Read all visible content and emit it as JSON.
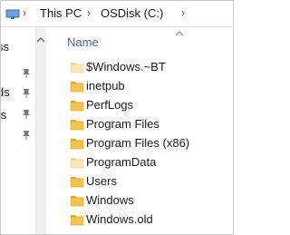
{
  "address": {
    "crumbs": [
      "This PC",
      "OSDisk (C:)"
    ],
    "separators": [
      "›",
      "›",
      "›"
    ]
  },
  "left_pane": {
    "labels": [
      "ss",
      "ds",
      "ts"
    ]
  },
  "column": {
    "name": "Name"
  },
  "folders": [
    {
      "name": "$Windows.~BT",
      "style": "hidden"
    },
    {
      "name": "inetpub",
      "style": "normal"
    },
    {
      "name": "PerfLogs",
      "style": "normal"
    },
    {
      "name": "Program Files",
      "style": "normal"
    },
    {
      "name": "Program Files (x86)",
      "style": "normal"
    },
    {
      "name": "ProgramData",
      "style": "hidden"
    },
    {
      "name": "Users",
      "style": "normal"
    },
    {
      "name": "Windows",
      "style": "normal"
    },
    {
      "name": "Windows.old",
      "style": "normal"
    }
  ],
  "colors": {
    "folder_normal": "#f4c54a",
    "folder_hidden": "#f9e8b5",
    "column_header_text": "#4d6a8c"
  },
  "icons": {
    "location": "this-pc-icon",
    "pin": "pin-icon",
    "folder": "folder-icon",
    "sort": "chevron-up-icon",
    "scroll_up": "scroll-up-arrow-icon"
  }
}
